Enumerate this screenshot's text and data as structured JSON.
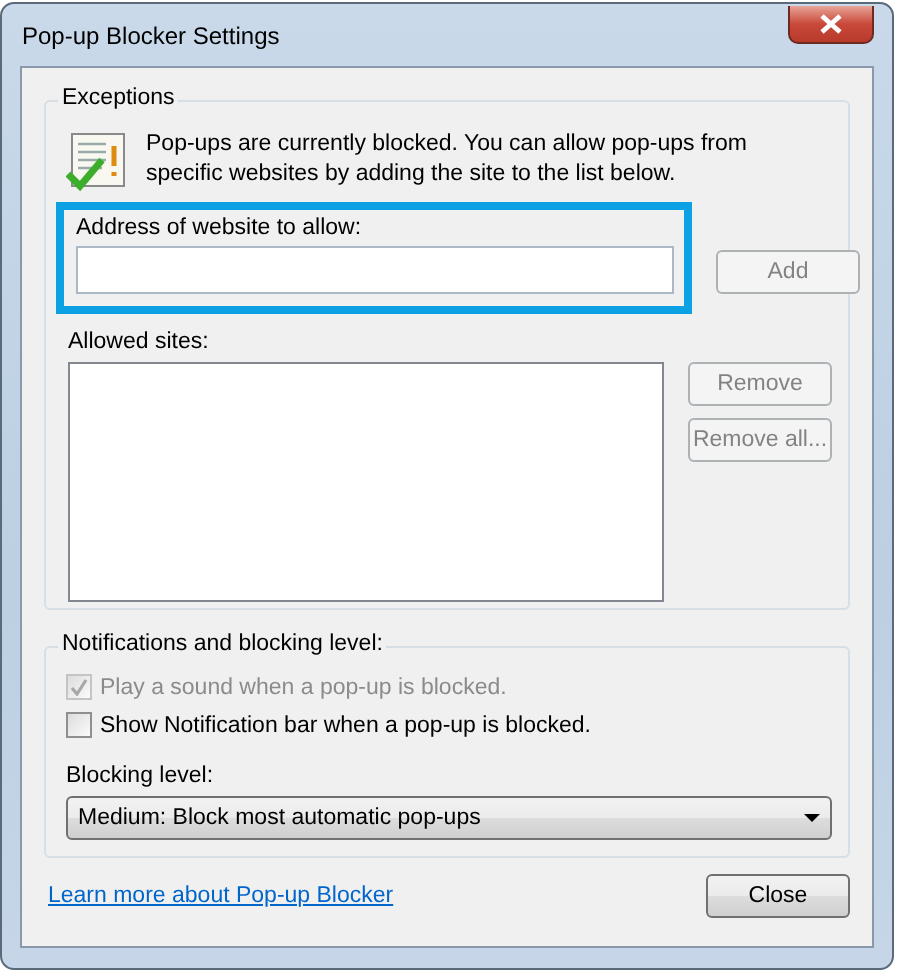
{
  "window": {
    "title": "Pop-up Blocker Settings"
  },
  "exceptions": {
    "title": "Exceptions",
    "message": "Pop-ups are currently blocked.  You can allow pop-ups from specific websites by adding the site to the list below.",
    "address_label": "Address of website to allow:",
    "add_button": {
      "label": "Add",
      "disabled": true
    },
    "allowed_label": "Allowed sites:",
    "buttons": [
      {
        "label": "Remove",
        "disabled": true
      },
      {
        "label": "Remove all...",
        "disabled": true
      }
    ]
  },
  "notifications": {
    "title": "Notifications and blocking level:",
    "checkboxes": [
      {
        "label": "Play a sound when a pop-up is blocked.",
        "checked": true,
        "disabled": true
      },
      {
        "label": "Show Notification bar when a pop-up is blocked.",
        "checked": false,
        "disabled": false
      }
    ],
    "level_label": "Blocking level:",
    "level_value": "Medium: Block most automatic pop-ups"
  },
  "footer": {
    "link": "Learn more about Pop-up Blocker",
    "close_button": {
      "label": "Close",
      "disabled": false
    }
  }
}
